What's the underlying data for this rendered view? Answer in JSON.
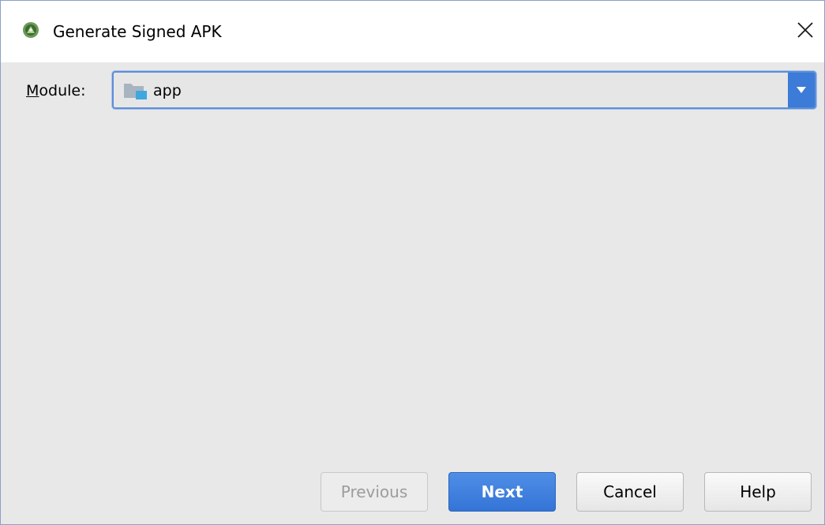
{
  "window": {
    "title": "Generate Signed APK",
    "app_icon": "android-studio-icon",
    "close_icon": "close-icon"
  },
  "module": {
    "label_mnemonic": "M",
    "label_rest": "odule:",
    "selected_value": "app",
    "value_icon": "module-folder-icon",
    "dropdown_icon": "chevron-down-icon"
  },
  "buttons": {
    "previous": "Previous",
    "next": "Next",
    "cancel": "Cancel",
    "help": "Help"
  },
  "colors": {
    "accent": "#3c7bd7",
    "focus_border": "#5e8ed6",
    "dialog_bg": "#e8e8e8"
  }
}
